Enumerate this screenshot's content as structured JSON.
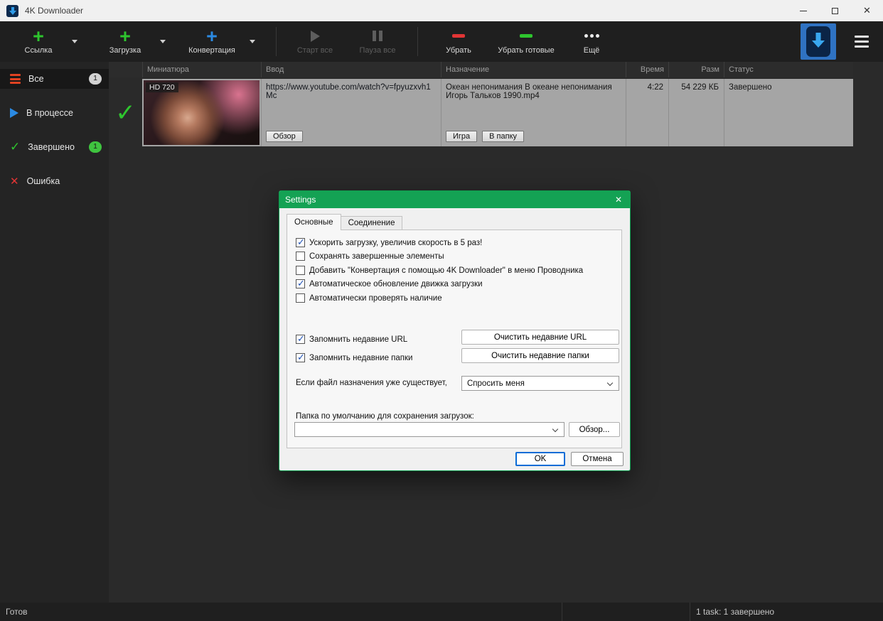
{
  "colors": {
    "green": "#2ec52e",
    "blue": "#2b8ae2",
    "red": "#e23535",
    "orange-red": "#e04222",
    "disabled-gray": "#5d5d5d",
    "dialog-green": "#14a254",
    "check-blue": "#1f51b5",
    "focus-blue": "#0a6cd6"
  },
  "titlebar": {
    "title": "4K Downloader"
  },
  "toolbar": {
    "link": {
      "label": "Ссылка"
    },
    "download": {
      "label": "Загрузка"
    },
    "convert": {
      "label": "Конвертация"
    },
    "start_all": {
      "label": "Старт все"
    },
    "pause_all": {
      "label": "Пауза все"
    },
    "remove": {
      "label": "Убрать"
    },
    "remove_done": {
      "label": "Убрать готовые"
    },
    "more": {
      "label": "Ещё"
    }
  },
  "sidebar": {
    "items": [
      {
        "label": "Все",
        "badge": "1"
      },
      {
        "label": "В процессе",
        "badge": ""
      },
      {
        "label": "Завершено",
        "badge": "1"
      },
      {
        "label": "Ошибка",
        "badge": ""
      }
    ]
  },
  "table": {
    "headers": [
      "Миниатюра",
      "Ввод",
      "Назначение",
      "Время",
      "Разм",
      "Статус"
    ],
    "rows": [
      {
        "quality": "HD 720",
        "url": "https://www.youtube.com/watch?v=fpyuzxvh1Mc",
        "browse_label": "Обзор",
        "destination": "Океан непонимания В океане непонимания Игорь Тальков 1990.mp4",
        "play_label": "Игра",
        "folder_label": "В папку",
        "time": "4:22",
        "size": "54 229 КБ",
        "status": "Завершено"
      }
    ]
  },
  "dialog": {
    "title": "Settings",
    "tabs": [
      {
        "label": "Основные"
      },
      {
        "label": "Соединение"
      }
    ],
    "options": [
      {
        "label": "Ускорить загрузку, увеличив скорость в 5 раз!",
        "checked": true
      },
      {
        "label": "Сохранять завершенные элементы",
        "checked": false
      },
      {
        "label": "Добавить \"Конвертация с помощью 4K Downloader\" в меню Проводника",
        "checked": false
      },
      {
        "label": "Автоматическое обновление движка загрузки",
        "checked": true
      },
      {
        "label": "Автоматически проверять наличие",
        "checked": false
      }
    ],
    "recent_url": {
      "label": "Запомнить недавние URL",
      "checked": true,
      "clear_label": "Очистить недавние URL"
    },
    "recent_folders": {
      "label": "Запомнить недавние папки",
      "checked": true,
      "clear_label": "Очистить недавние папки"
    },
    "exists": {
      "label": "Если файл назначения уже существует,",
      "value": "Спросить меня"
    },
    "default_folder": {
      "label": "Папка по умолчанию для сохранения загрузок:",
      "value": "",
      "browse_label": "Обзор..."
    },
    "ok_label": "OK",
    "cancel_label": "Отмена"
  },
  "statusbar": {
    "ready": "Готов",
    "tasks": "1 task: 1 завершено"
  }
}
